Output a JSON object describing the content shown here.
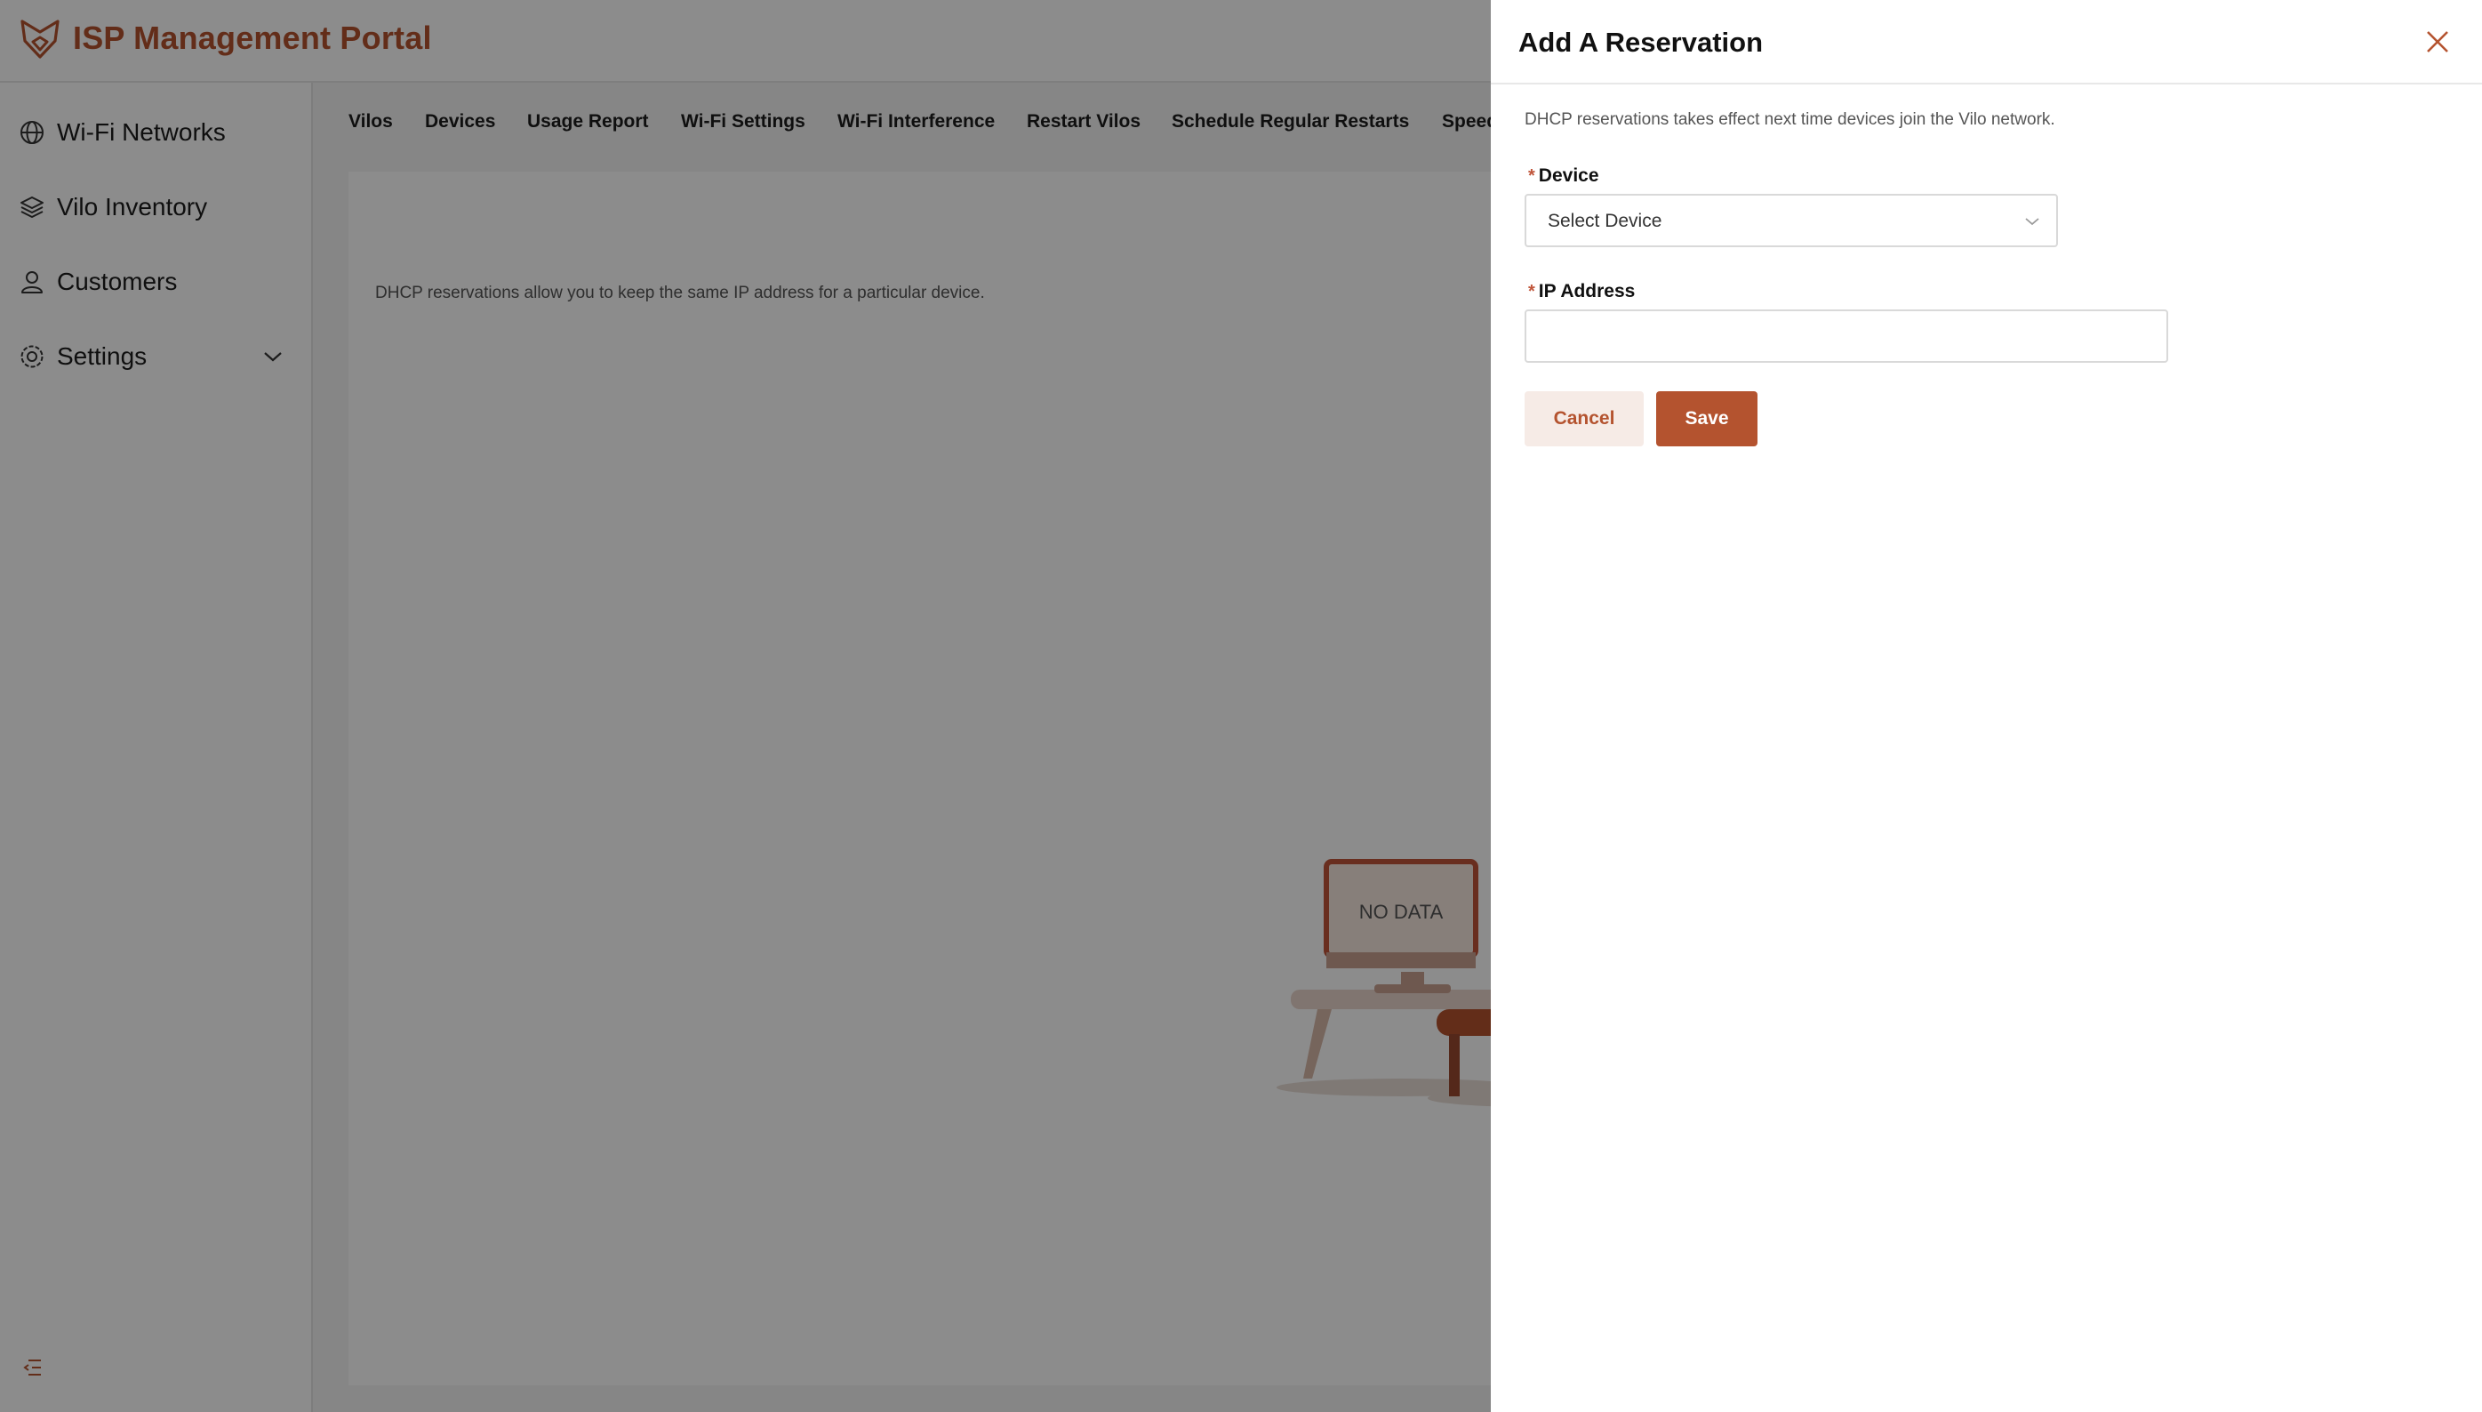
{
  "header": {
    "app_title": "ISP Management Portal",
    "logo_icon": "fox-logo-icon"
  },
  "colors": {
    "brand": "#b4532f",
    "brand_light": "#f6ebe6",
    "overlay": "rgba(0,0,0,0.45)"
  },
  "sidebar": {
    "items": [
      {
        "label": "Wi-Fi Networks",
        "icon": "globe-icon"
      },
      {
        "label": "Vilo Inventory",
        "icon": "layers-icon"
      },
      {
        "label": "Customers",
        "icon": "user-icon"
      },
      {
        "label": "Settings",
        "icon": "gear-icon",
        "expandable": true
      }
    ],
    "collapse_icon": "menu-fold-icon"
  },
  "main": {
    "tabs": [
      {
        "label": "Vilos"
      },
      {
        "label": "Devices"
      },
      {
        "label": "Usage Report"
      },
      {
        "label": "Wi-Fi Settings"
      },
      {
        "label": "Wi-Fi Interference"
      },
      {
        "label": "Restart Vilos"
      },
      {
        "label": "Schedule Regular Restarts"
      },
      {
        "label": "Speed"
      }
    ],
    "description": "DHCP reservations allow you to keep the same IP address for a particular device.",
    "empty_state": {
      "label": "NO DATA"
    }
  },
  "drawer": {
    "title": "Add A Reservation",
    "description": "DHCP reservations takes effect next time devices join the Vilo network.",
    "device": {
      "label": "Device",
      "required_mark": "*",
      "selected_value": "Select Device"
    },
    "ip_address": {
      "label": "IP Address",
      "required_mark": "*",
      "value": "",
      "placeholder": ""
    },
    "cancel_label": "Cancel",
    "save_label": "Save"
  }
}
